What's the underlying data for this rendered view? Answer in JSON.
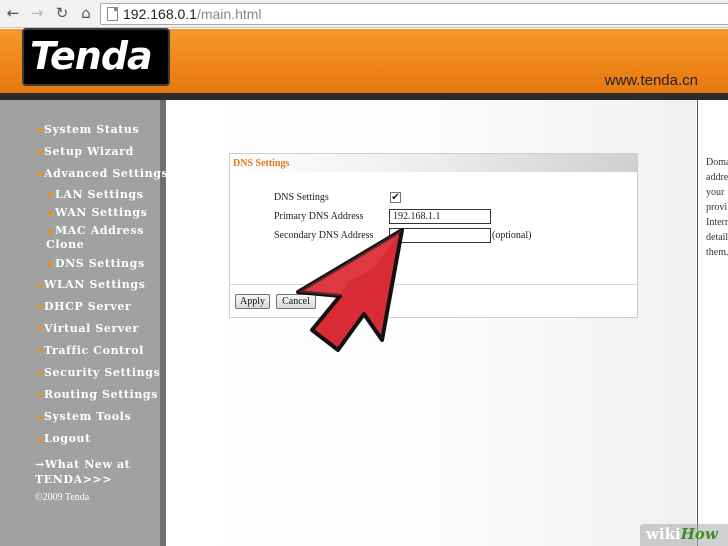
{
  "browser": {
    "url_host": "192.168.0.1",
    "url_path": "/main.html"
  },
  "header": {
    "logo_text": "Tenda",
    "site_url": "www.tenda.cn",
    "colors": {
      "orange": "#f08519",
      "black": "#000000"
    }
  },
  "sidebar": {
    "items": [
      {
        "label": "System Status",
        "level": 1
      },
      {
        "label": "Setup Wizard",
        "level": 1
      },
      {
        "label": "Advanced Settings",
        "level": 1
      },
      {
        "label": "LAN Settings",
        "level": 2
      },
      {
        "label": "WAN Settings",
        "level": 2
      },
      {
        "label": "MAC Address",
        "level": 2
      },
      {
        "label": "Clone",
        "level": 2
      },
      {
        "label": "DNS Settings",
        "level": 2
      },
      {
        "label": "WLAN Settings",
        "level": 1
      },
      {
        "label": "DHCP Server",
        "level": 1
      },
      {
        "label": "Virtual Server",
        "level": 1
      },
      {
        "label": "Traffic Control",
        "level": 1
      },
      {
        "label": "Security Settings",
        "level": 1
      },
      {
        "label": "Routing Settings",
        "level": 1
      },
      {
        "label": "System Tools",
        "level": 1
      },
      {
        "label": "Logout",
        "level": 1
      }
    ],
    "whats_new_line1": "→What New at",
    "whats_new_line2": "TENDA>>>",
    "copyright": "©2009 Tenda"
  },
  "dns_panel": {
    "title": "DNS Settings",
    "enable_label": "DNS Settings",
    "enable_checked": true,
    "primary_label": "Primary DNS Address",
    "primary_value": "192.168.1.1",
    "secondary_label": "Secondary DNS Address",
    "secondary_value": "",
    "optional_label": "(optional)",
    "apply_label": "Apply",
    "cancel_label": "Cancel"
  },
  "help_panel": {
    "lines": [
      "Doma",
      "addre",
      "your",
      "provi",
      "Intern",
      "detail",
      "them."
    ]
  },
  "annotation": {
    "arrow_color": "#d92b36"
  },
  "watermark": {
    "wiki": "wiki",
    "how": "How"
  }
}
